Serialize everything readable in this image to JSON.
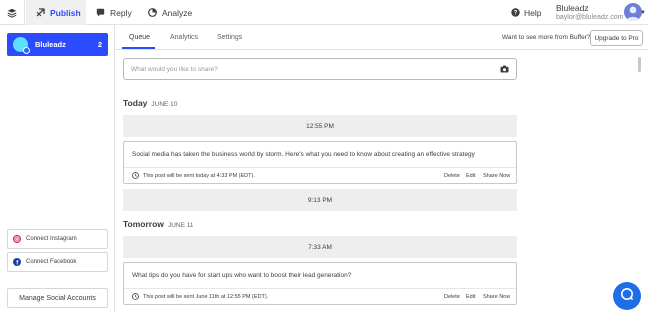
{
  "nav": {
    "tabs": [
      {
        "label": "Publish",
        "icon": "publish-icon"
      },
      {
        "label": "Reply",
        "icon": "reply-icon"
      },
      {
        "label": "Analyze",
        "icon": "analyze-icon"
      }
    ],
    "help_label": "Help",
    "user_name": "Bluleadz",
    "user_email": "baylor@bluleadz.com",
    "accent": "#2c4bff"
  },
  "sidebar": {
    "profile": {
      "name": "Bluleadz",
      "count": "2",
      "color": "#2c4bff"
    },
    "connect_instagram": "Connect Instagram",
    "connect_facebook": "Connect Facebook",
    "manage_label": "Manage Social Accounts"
  },
  "subtabs": {
    "items": [
      {
        "label": "Queue",
        "active": true
      },
      {
        "label": "Analytics",
        "active": false
      },
      {
        "label": "Settings",
        "active": false
      }
    ],
    "promo_text": "Want to see more from Buffer?",
    "upgrade_label": "Upgrade to Pro"
  },
  "composer": {
    "placeholder": "What would you like to share?",
    "icon": "camera-icon"
  },
  "queue": {
    "days": [
      {
        "heading": "Today",
        "date": "JUNE 10",
        "slots": [
          "12:55 PM",
          "9:13 PM"
        ],
        "post": {
          "text": "Social media has taken the business world by storm. Here's what you need to know about creating an effective strategy",
          "schedule": "This post will be sent today at 4:33 PM (EDT).",
          "actions": {
            "delete": "Delete",
            "edit": "Edit",
            "share": "Share Now"
          }
        }
      },
      {
        "heading": "Tomorrow",
        "date": "JUNE 11",
        "slots": [
          "7:33 AM"
        ],
        "post": {
          "text": "What tips do you have for start ups who want to boost their lead generation?",
          "schedule": "This post will be sent June 11th at 12:55 PM (EDT).",
          "actions": {
            "delete": "Delete",
            "edit": "Edit",
            "share": "Share Now"
          }
        }
      }
    ]
  },
  "chat": {
    "icon": "chat-bubble-icon",
    "color": "#1d6ee8"
  }
}
